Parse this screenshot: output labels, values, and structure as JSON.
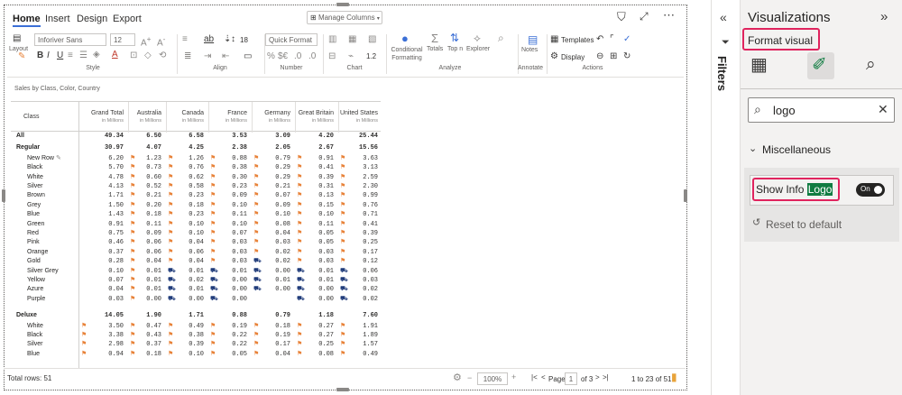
{
  "ribbon": {
    "tabs": [
      "Home",
      "Insert",
      "Design",
      "Export"
    ],
    "manage_columns": "Manage Columns",
    "font_name": "Inforiver Sans",
    "font_size": "12",
    "layout_label": "Layout",
    "row_height": "18",
    "number_format": "Quick Format",
    "decimals_value": "1.2",
    "groups": {
      "style": "Style",
      "align": "Align",
      "number": "Number",
      "chart": "Chart",
      "analyze": "Analyze",
      "annotate": "Annotate",
      "actions": "Actions"
    },
    "analyze": {
      "conditional_formatting": "Conditional Formatting",
      "totals": "Totals",
      "topn": "Top n",
      "explorer": "Explorer"
    },
    "notes": "Notes",
    "templates": "Templates",
    "display": "Display"
  },
  "table": {
    "subtitle": "Sales by Class, Color, Country",
    "class_header": "Class",
    "unit": "in Millions",
    "columns": [
      "Grand Total",
      "Australia",
      "Canada",
      "France",
      "Germany",
      "Great Britain",
      "United States"
    ],
    "rows": [
      {
        "label": "All",
        "type": "grp",
        "sym": "⊟",
        "vals": [
          "49.34",
          "6.50",
          "6.58",
          "3.53",
          "3.09",
          "4.20",
          "25.44"
        ]
      },
      {
        "label": "Regular",
        "type": "grp",
        "sym": "⊟",
        "vals": [
          "30.97",
          "4.07",
          "4.25",
          "2.38",
          "2.05",
          "2.67",
          "15.56"
        ]
      },
      {
        "label": "New Row",
        "type": "item",
        "sym": "✎",
        "vals": [
          "6.20",
          "1.23",
          "1.26",
          "0.88",
          "0.79",
          "0.91",
          "3.63"
        ],
        "icons": [
          "flag",
          "flag",
          "flag",
          "flag",
          "flag",
          "flag"
        ]
      },
      {
        "label": "Black",
        "type": "item",
        "vals": [
          "5.70",
          "0.73",
          "0.76",
          "0.38",
          "0.29",
          "0.41",
          "3.13"
        ],
        "icons": [
          "flag",
          "flag",
          "flag",
          "flag",
          "flag",
          "flag"
        ]
      },
      {
        "label": "White",
        "type": "item",
        "vals": [
          "4.78",
          "0.60",
          "0.62",
          "0.30",
          "0.29",
          "0.39",
          "2.59"
        ],
        "icons": [
          "flag",
          "flag",
          "flag",
          "flag",
          "flag",
          "flag"
        ]
      },
      {
        "label": "Silver",
        "type": "item",
        "vals": [
          "4.13",
          "0.52",
          "0.58",
          "0.23",
          "0.21",
          "0.31",
          "2.30"
        ],
        "icons": [
          "flag",
          "flag",
          "flag",
          "flag",
          "flag",
          "flag"
        ]
      },
      {
        "label": "Brown",
        "type": "item",
        "vals": [
          "1.71",
          "0.21",
          "0.23",
          "0.09",
          "0.07",
          "0.13",
          "0.99"
        ],
        "icons": [
          "flag",
          "flag",
          "flag",
          "flag",
          "flag",
          "flag"
        ]
      },
      {
        "label": "Grey",
        "type": "item",
        "vals": [
          "1.50",
          "0.20",
          "0.18",
          "0.10",
          "0.09",
          "0.15",
          "0.76"
        ],
        "icons": [
          "flag",
          "flag",
          "flag",
          "flag",
          "flag",
          "flag"
        ]
      },
      {
        "label": "Blue",
        "type": "item",
        "vals": [
          "1.43",
          "0.18",
          "0.23",
          "0.11",
          "0.10",
          "0.10",
          "0.71"
        ],
        "icons": [
          "flag",
          "flag",
          "flag",
          "flag",
          "flag",
          "flag"
        ]
      },
      {
        "label": "Green",
        "type": "item",
        "vals": [
          "0.91",
          "0.11",
          "0.10",
          "0.10",
          "0.08",
          "0.11",
          "0.41"
        ],
        "icons": [
          "flag",
          "flag",
          "flag",
          "flag",
          "flag",
          "flag"
        ]
      },
      {
        "label": "Red",
        "type": "item",
        "vals": [
          "0.75",
          "0.09",
          "0.10",
          "0.07",
          "0.04",
          "0.05",
          "0.39"
        ],
        "icons": [
          "flag",
          "flag",
          "flag",
          "flag",
          "flag",
          "flag"
        ]
      },
      {
        "label": "Pink",
        "type": "item",
        "vals": [
          "0.46",
          "0.06",
          "0.04",
          "0.03",
          "0.03",
          "0.05",
          "0.25"
        ],
        "icons": [
          "flag",
          "flag",
          "flag",
          "flag",
          "flag",
          "flag"
        ]
      },
      {
        "label": "Orange",
        "type": "item",
        "vals": [
          "0.37",
          "0.06",
          "0.06",
          "0.03",
          "0.02",
          "0.03",
          "0.17"
        ],
        "icons": [
          "flag",
          "flag",
          "flag",
          "flag",
          "flag",
          "flag"
        ]
      },
      {
        "label": "Gold",
        "type": "item",
        "vals": [
          "0.28",
          "0.04",
          "0.04",
          "0.03",
          "0.02",
          "0.03",
          "0.12"
        ],
        "icons": [
          "flag",
          "flag",
          "flag",
          "truck",
          "flag",
          "flag"
        ]
      },
      {
        "label": "Silver Grey",
        "type": "item",
        "vals": [
          "0.10",
          "0.01",
          "0.01",
          "0.01",
          "0.00",
          "0.01",
          "0.06"
        ],
        "icons": [
          "flag",
          "truck",
          "truck",
          "truck",
          "truck",
          "truck"
        ]
      },
      {
        "label": "Yellow",
        "type": "item",
        "vals": [
          "0.07",
          "0.01",
          "0.02",
          "0.00",
          "0.01",
          "0.01",
          "0.03"
        ],
        "icons": [
          "flag",
          "truck",
          "truck",
          "truck",
          "truck",
          "truck"
        ]
      },
      {
        "label": "Azure",
        "type": "item",
        "vals": [
          "0.04",
          "0.01",
          "0.01",
          "0.00",
          "0.00",
          "0.00",
          "0.02"
        ],
        "icons": [
          "flag",
          "truck",
          "truck",
          "truck",
          "truck",
          "truck"
        ]
      },
      {
        "label": "Purple",
        "type": "item",
        "vals": [
          "0.03",
          "0.00",
          "0.00",
          "0.00",
          "",
          "0.00",
          "0.02"
        ],
        "icons": [
          "flag",
          "truck",
          "truck",
          "",
          "truck",
          "truck"
        ]
      },
      {
        "label": "",
        "type": "spacer",
        "vals": []
      },
      {
        "label": "Deluxe",
        "type": "grp",
        "sym": "⊟",
        "vals": [
          "14.05",
          "1.90",
          "1.71",
          "0.88",
          "0.79",
          "1.18",
          "7.60"
        ]
      },
      {
        "label": "White",
        "type": "item",
        "vals": [
          "3.50",
          "0.47",
          "0.49",
          "0.19",
          "0.18",
          "0.27",
          "1.91"
        ],
        "icons": [
          "flag",
          "flag",
          "flag",
          "flag",
          "flag",
          "flag"
        ],
        "lead": "flag"
      },
      {
        "label": "Black",
        "type": "item",
        "vals": [
          "3.38",
          "0.43",
          "0.38",
          "0.22",
          "0.19",
          "0.27",
          "1.89"
        ],
        "icons": [
          "flag",
          "flag",
          "flag",
          "flag",
          "flag",
          "flag"
        ],
        "lead": "flag"
      },
      {
        "label": "Silver",
        "type": "item",
        "vals": [
          "2.98",
          "0.37",
          "0.39",
          "0.22",
          "0.17",
          "0.25",
          "1.57"
        ],
        "icons": [
          "flag",
          "flag",
          "flag",
          "flag",
          "flag",
          "flag"
        ],
        "lead": "flag"
      },
      {
        "label": "Blue",
        "type": "item",
        "vals": [
          "0.94",
          "0.18",
          "0.10",
          "0.05",
          "0.04",
          "0.08",
          "0.49"
        ],
        "icons": [
          "flag",
          "flag",
          "flag",
          "flag",
          "flag",
          "flag"
        ],
        "lead": "flag"
      }
    ]
  },
  "footer": {
    "total_rows": "Total rows: 51",
    "zoom": "100%",
    "page_label": "Page",
    "page_value": "1",
    "page_of": "of 3",
    "range": "1 to 23 of 51"
  },
  "filters": {
    "label": "Filters"
  },
  "viz": {
    "title": "Visualizations",
    "format_visual": "Format visual",
    "search_value": "logo",
    "section": "Miscellaneous",
    "setting_prefix": "Show Info",
    "setting_highlight": "Logo",
    "toggle": "On",
    "reset": "Reset to default"
  },
  "colors": {
    "accent": "#3b6fd6",
    "highlight": "#e0245e",
    "flag": "#e8833a",
    "truck": "#1f3b7a",
    "search_hit": "#107c41"
  }
}
